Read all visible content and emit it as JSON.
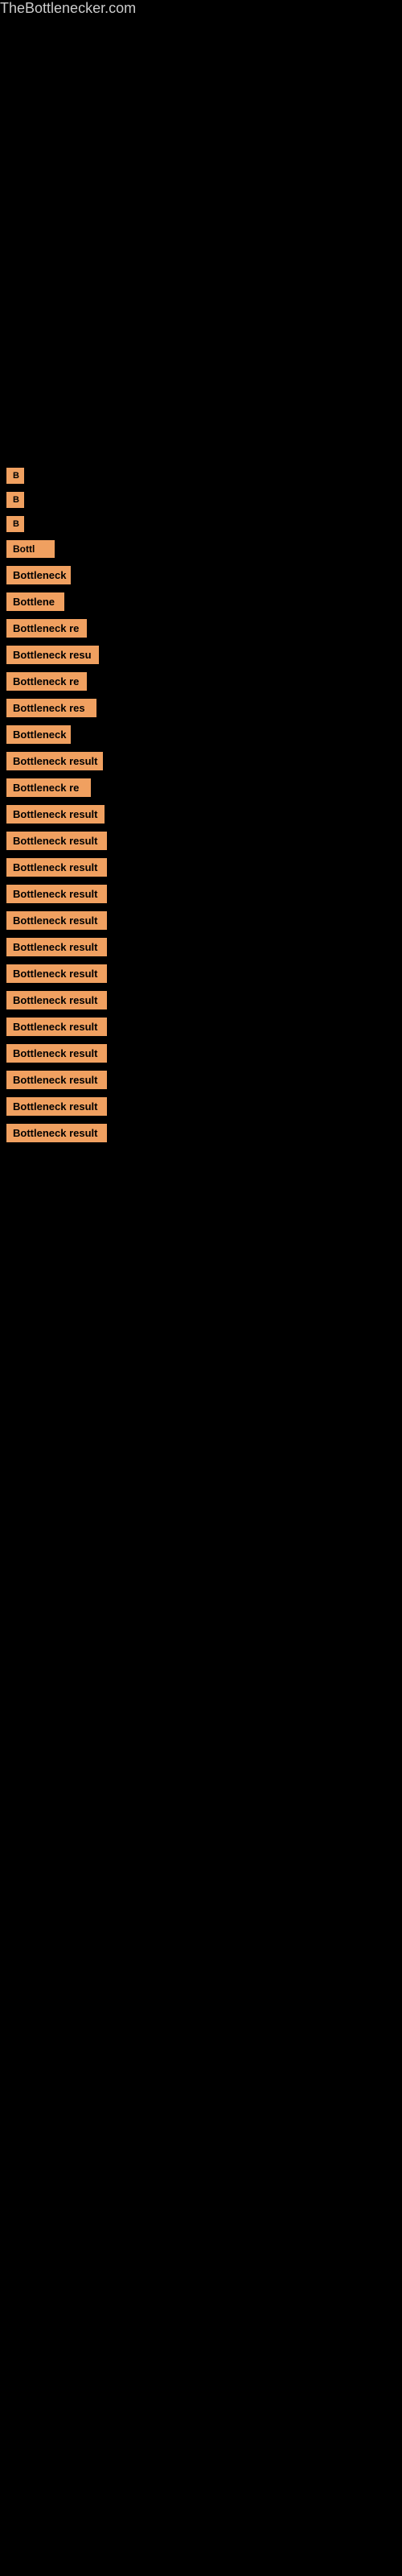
{
  "site": {
    "title": "TheBottlenecker.com"
  },
  "results": [
    {
      "label": "B",
      "short": true
    },
    {
      "label": "B",
      "short": true
    },
    {
      "label": "B",
      "short": true
    },
    {
      "label": "Bottl...",
      "short": false
    },
    {
      "label": "Bottleneck",
      "short": false
    },
    {
      "label": "Bottlen...",
      "short": false
    },
    {
      "label": "Bottleneck re",
      "short": false
    },
    {
      "label": "Bottleneck resu",
      "short": false
    },
    {
      "label": "Bottleneck re",
      "short": false
    },
    {
      "label": "Bottleneck res",
      "short": false
    },
    {
      "label": "Bottleneck",
      "short": false
    },
    {
      "label": "Bottleneck result",
      "short": false
    },
    {
      "label": "Bottleneck re",
      "short": false
    },
    {
      "label": "Bottleneck result",
      "short": false
    },
    {
      "label": "Bottleneck result",
      "short": false
    },
    {
      "label": "Bottleneck result",
      "short": false
    },
    {
      "label": "Bottleneck result",
      "short": false
    },
    {
      "label": "Bottleneck result",
      "short": false
    },
    {
      "label": "Bottleneck result",
      "short": false
    },
    {
      "label": "Bottleneck result",
      "short": false
    },
    {
      "label": "Bottleneck result",
      "short": false
    },
    {
      "label": "Bottleneck result",
      "short": false
    },
    {
      "label": "Bottleneck result",
      "short": false
    },
    {
      "label": "Bottleneck result",
      "short": false
    },
    {
      "label": "Bottleneck result",
      "short": false
    },
    {
      "label": "Bottleneck result",
      "short": false
    }
  ]
}
